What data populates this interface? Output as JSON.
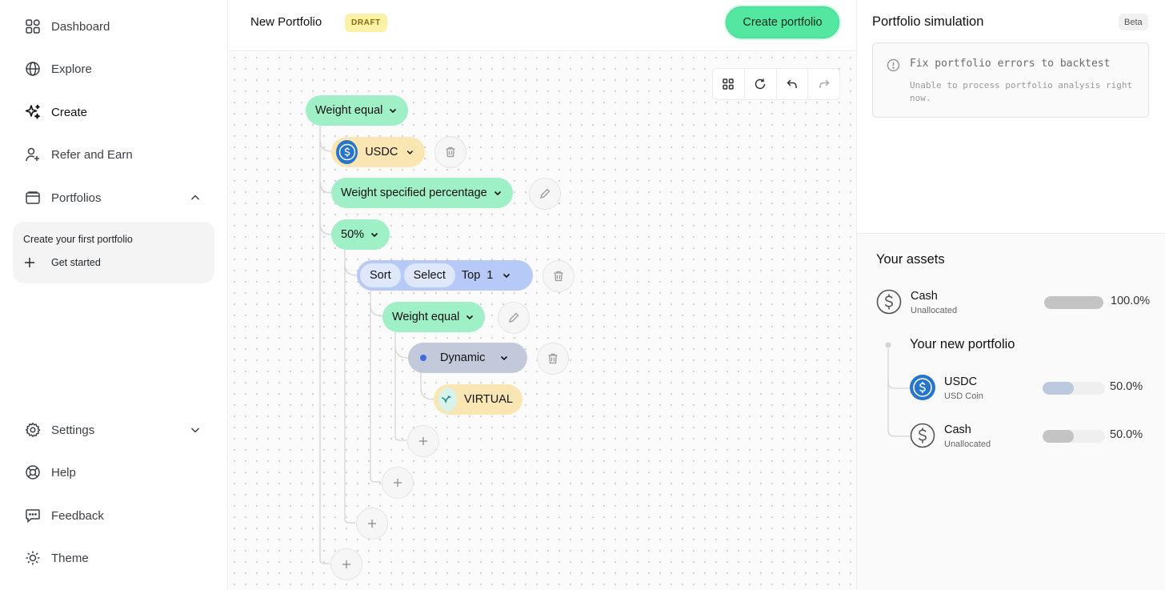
{
  "sidebar": {
    "nav": [
      {
        "label": "Dashboard",
        "icon": "dashboard-grid-icon"
      },
      {
        "label": "Explore",
        "icon": "globe-icon"
      },
      {
        "label": "Create",
        "icon": "sparkles-icon",
        "active": true
      },
      {
        "label": "Refer and Earn",
        "icon": "user-plus-icon"
      },
      {
        "label": "Portfolios",
        "icon": "wallet-icon",
        "expanded": true
      }
    ],
    "promo": {
      "title": "Create your first portfolio",
      "action": "Get started"
    },
    "bottom": [
      {
        "label": "Settings",
        "icon": "gear-icon"
      },
      {
        "label": "Help",
        "icon": "lifebuoy-icon"
      },
      {
        "label": "Feedback",
        "icon": "chat-icon"
      },
      {
        "label": "Theme",
        "icon": "sun-icon"
      }
    ]
  },
  "header": {
    "title": "New Portfolio",
    "badge": "DRAFT",
    "create_label": "Create portfolio"
  },
  "canvas": {
    "nodes": {
      "weight_equal_root": "Weight equal",
      "usdc": "USDC",
      "weight_specified": "Weight specified percentage",
      "percent": "50%",
      "sort": "Sort",
      "select": "Select",
      "top": "Top",
      "top_n": "1",
      "weight_equal_inner": "Weight equal",
      "dynamic": "Dynamic",
      "virtual": "VIRTUAL"
    }
  },
  "simulation": {
    "title": "Portfolio simulation",
    "badge": "Beta",
    "error_title": "Fix portfolio errors to backtest",
    "error_detail": "Unable to process portfolio analysis right now."
  },
  "assets": {
    "title": "Your assets",
    "cash": {
      "name": "Cash",
      "sub": "Unallocated",
      "pct_label": "100.0%",
      "fraction": 1.0
    },
    "portfolio_title": "Your new portfolio",
    "items": [
      {
        "name": "USDC",
        "sub": "USD Coin",
        "pct_label": "50.0%",
        "fraction": 0.5,
        "color": "#bcc9de"
      },
      {
        "name": "Cash",
        "sub": "Unallocated",
        "pct_label": "50.0%",
        "fraction": 0.5,
        "color": "#c4c4c4"
      }
    ]
  },
  "colors": {
    "accent_green": "#54e7a2",
    "node_green": "#9ff0c7",
    "node_yellow": "#fae6b2",
    "node_blue": "#b7c9f6",
    "usdc_blue": "#2775ca"
  }
}
